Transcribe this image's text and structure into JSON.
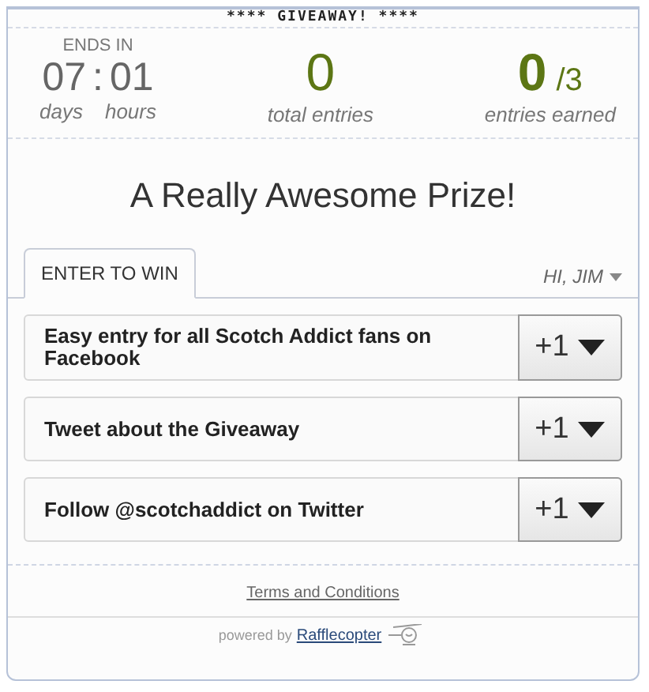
{
  "banner": "**** GIVEAWAY! ****",
  "countdown": {
    "label": "ENDS IN",
    "days": "07",
    "separator": ":",
    "hours": "01",
    "days_label": "days",
    "hours_label": "hours"
  },
  "total_entries": {
    "value": "0",
    "label": "total entries"
  },
  "entries_earned": {
    "value": "0",
    "total": "/3",
    "label": "entries earned"
  },
  "prize": "A Really Awesome Prize!",
  "tabs": [
    {
      "label": "ENTER TO WIN",
      "selected": true
    }
  ],
  "user_menu": "HI, JIM",
  "entries": [
    {
      "label": "Easy entry for all Scotch Addict fans on Facebook",
      "points": "+1"
    },
    {
      "label": "Tweet about the Giveaway",
      "points": "+1"
    },
    {
      "label": "Follow @scotchaddict on Twitter",
      "points": "+1"
    }
  ],
  "terms_link": "Terms and Conditions",
  "footer": {
    "text": "powered by",
    "brand": "Rafflecopter"
  }
}
